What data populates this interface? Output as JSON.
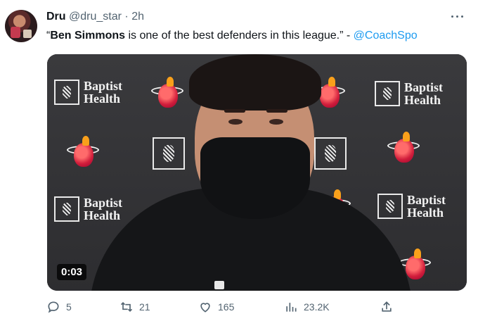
{
  "tweet": {
    "author_name": "Dru",
    "author_handle": "@dru_star",
    "separator": "·",
    "time": "2h",
    "text_quote_open": "“",
    "text_bold": "Ben Simmons",
    "text_rest": " is one of the best defenders in this league.” - ",
    "text_mention": "@CoachSpo"
  },
  "media": {
    "duration": "0:03",
    "sponsor_logo_text": [
      "Baptist",
      "Health"
    ]
  },
  "actions": {
    "replies": "5",
    "retweets": "21",
    "likes": "165",
    "views": "23.2K"
  },
  "icons": {
    "more": "more-icon",
    "reply": "reply-icon",
    "retweet": "retweet-icon",
    "like": "like-icon",
    "views": "views-icon",
    "share": "share-icon"
  },
  "colors": {
    "text": "#0f1419",
    "secondary": "#536471",
    "link": "#1d9bf0"
  }
}
